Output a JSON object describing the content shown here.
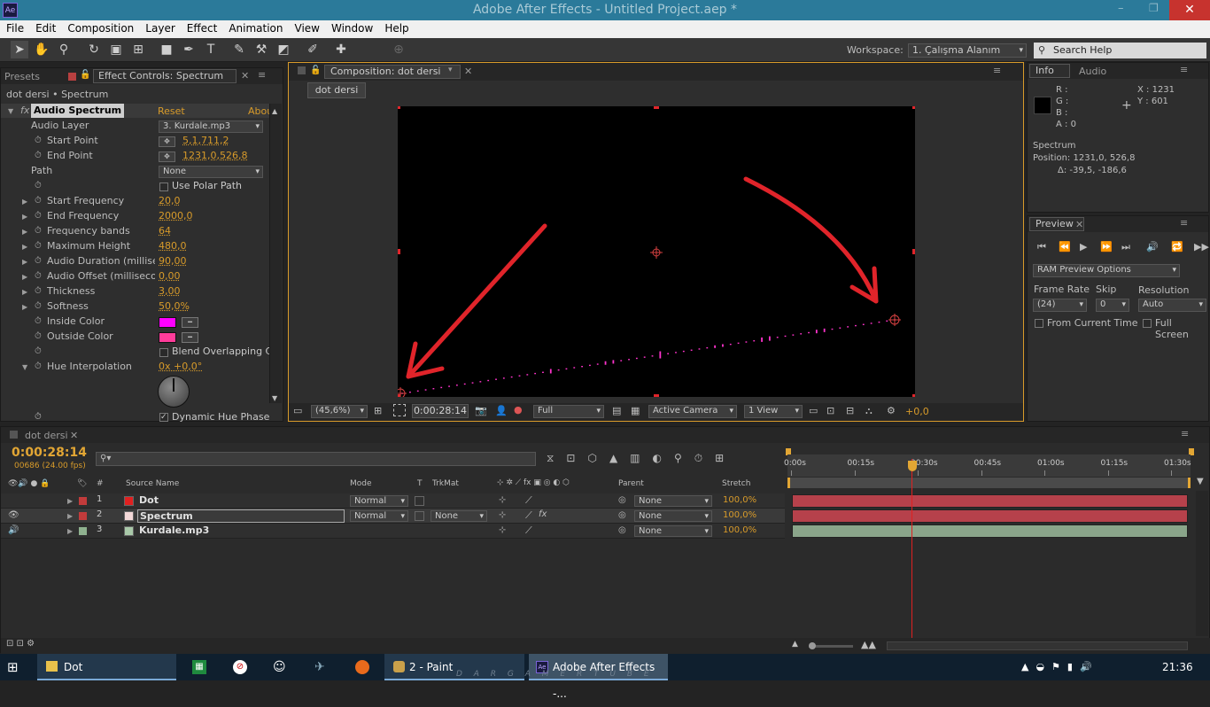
{
  "window": {
    "title": "Adobe After Effects - Untitled Project.aep *",
    "app_icon": "Ae"
  },
  "menu": [
    "File",
    "Edit",
    "Composition",
    "Layer",
    "Effect",
    "Animation",
    "View",
    "Window",
    "Help"
  ],
  "toolbar": {
    "workspace_label": "Workspace:",
    "workspace_value": "1. Çalışma Alanım",
    "search_placeholder": "Search Help"
  },
  "effect_panel": {
    "presets_tab": "Presets",
    "tab": "Effect Controls: Spectrum",
    "breadcrumb": "dot dersi • Spectrum",
    "effect_name": "Audio Spectrum",
    "reset": "Reset",
    "about": "Abou",
    "params": [
      {
        "label": "Audio Layer",
        "value": "3. Kurdale.mp3",
        "kind": "dropdown"
      },
      {
        "label": "Start Point",
        "value": "5,1,711,2",
        "kind": "point"
      },
      {
        "label": "End Point",
        "value": "1231,0,526,8",
        "kind": "point"
      },
      {
        "label": "Path",
        "value": "None",
        "kind": "dropdown"
      },
      {
        "label": "",
        "value": "Use Polar Path",
        "kind": "checkbox"
      },
      {
        "label": "Start Frequency",
        "value": "20,0"
      },
      {
        "label": "End Frequency",
        "value": "2000,0"
      },
      {
        "label": "Frequency bands",
        "value": "64"
      },
      {
        "label": "Maximum Height",
        "value": "480,0"
      },
      {
        "label": "Audio Duration (millisec",
        "value": "90,00"
      },
      {
        "label": "Audio Offset (millisecon",
        "value": "0,00"
      },
      {
        "label": "Thickness",
        "value": "3,00"
      },
      {
        "label": "Softness",
        "value": "50,0%"
      },
      {
        "label": "Inside Color",
        "value": "",
        "kind": "color",
        "color": "#ff00ff"
      },
      {
        "label": "Outside Color",
        "value": "",
        "kind": "color",
        "color": "#ff3c9a"
      },
      {
        "label": "",
        "value": "Blend Overlapping C",
        "kind": "checkbox"
      },
      {
        "label": "Hue Interpolation",
        "value": "0x +0,0°"
      }
    ],
    "dynamic_hue": "Dynamic Hue Phase"
  },
  "comp_panel": {
    "tab": "Composition: dot dersi",
    "comp_button": "dot dersi",
    "zoom": "(45,6%)",
    "timecode": "0:00:28:14",
    "resolution": "Full",
    "camera": "Active Camera",
    "views": "1 View",
    "exposure": "+0,0"
  },
  "info_panel": {
    "tab_info": "Info",
    "tab_audio": "Audio",
    "r": "R :",
    "g": "G :",
    "b": "B :",
    "a": "A : 0",
    "x": "X : 1231",
    "y": "Y : 601",
    "layer": "Spectrum",
    "position": "Position: 1231,0, 526,8",
    "delta": "Δ: -39,5, -186,6"
  },
  "preview_panel": {
    "tab": "Preview",
    "ram_options": "RAM Preview Options",
    "frame_rate_label": "Frame Rate",
    "frame_rate": "(24)",
    "skip_label": "Skip",
    "skip": "0",
    "resolution_label": "Resolution",
    "resolution": "Auto",
    "from_current": "From Current Time",
    "full_screen": "Full Screen"
  },
  "timeline": {
    "tab": "dot dersi",
    "timecode": "0:00:28:14",
    "frames": "00686 (24.00 fps)",
    "columns": {
      "num": "#",
      "source": "Source Name",
      "mode": "Mode",
      "t": "T",
      "trkmat": "TrkMat",
      "parent": "Parent",
      "stretch": "Stretch"
    },
    "ruler": [
      "0:00s",
      "00:15s",
      "00:30s",
      "00:45s",
      "01:00s",
      "01:15s",
      "01:30s"
    ],
    "layers": [
      {
        "num": "1",
        "name": "Dot",
        "mode": "Normal",
        "trkmat": "",
        "parent": "None",
        "stretch": "100,0%",
        "color": "#e02020"
      },
      {
        "num": "2",
        "name": "Spectrum",
        "mode": "Normal",
        "trkmat": "None",
        "parent": "None",
        "stretch": "100,0%",
        "color": "#f2d7d7"
      },
      {
        "num": "3",
        "name": "Kurdale.mp3",
        "mode": "",
        "trkmat": "",
        "parent": "None",
        "stretch": "100,0%",
        "color": "#a9c9a9"
      }
    ]
  },
  "taskbar": {
    "items": [
      "Dot",
      "2 - Paint",
      "Adobe After Effects -..."
    ],
    "time": "21:36",
    "watermark": "D A R  G A M E R  T U B E"
  },
  "colors": {
    "accent": "#d89b2a",
    "titlebar": "#2b7a9a",
    "track_red": "#b6414b",
    "track_green": "#8aa58a",
    "arrow": "#e0242a"
  }
}
